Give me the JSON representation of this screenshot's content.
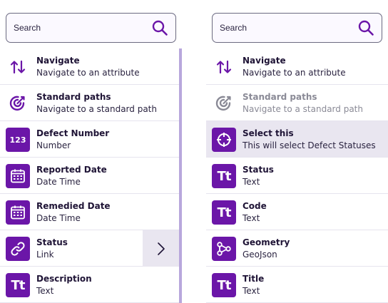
{
  "colors": {
    "accent": "#6b16a8",
    "selected_bg": "#e9e6f0",
    "scrollbar": "#b8a7dc",
    "muted": "#8a8a96"
  },
  "left": {
    "search": {
      "placeholder": "Search",
      "icon": "search-icon"
    },
    "items": [
      {
        "icon": "sort-arrows-icon",
        "title": "Navigate",
        "subtitle": "Navigate to an attribute"
      },
      {
        "icon": "target-icon",
        "title": "Standard paths",
        "subtitle": "Navigate to a standard path"
      },
      {
        "icon": "number-icon",
        "icon_text": "123",
        "title": "Defect Number",
        "subtitle": "Number"
      },
      {
        "icon": "calendar-icon",
        "title": "Reported Date",
        "subtitle": "Date Time"
      },
      {
        "icon": "calendar-icon",
        "title": "Remedied Date",
        "subtitle": "Date Time"
      },
      {
        "icon": "link-icon",
        "title": "Status",
        "subtitle": "Link",
        "action_icon": "chevron-right-icon"
      },
      {
        "icon": "text-icon",
        "icon_text": "Tt",
        "title": "Description",
        "subtitle": "Text"
      }
    ]
  },
  "right": {
    "search": {
      "placeholder": "Search",
      "icon": "search-icon"
    },
    "items": [
      {
        "icon": "sort-arrows-icon",
        "title": "Navigate",
        "subtitle": "Navigate to an attribute"
      },
      {
        "icon": "target-icon",
        "title": "Standard paths",
        "subtitle": "Navigate to a standard path",
        "state": "disabled"
      },
      {
        "icon": "crosshair-icon",
        "title": "Select this",
        "subtitle": "This will select Defect Statuses",
        "state": "selected"
      },
      {
        "icon": "text-icon",
        "icon_text": "Tt",
        "title": "Status",
        "subtitle": "Text"
      },
      {
        "icon": "text-icon",
        "icon_text": "Tt",
        "title": "Code",
        "subtitle": "Text"
      },
      {
        "icon": "geometry-icon",
        "title": "Geometry",
        "subtitle": "GeoJson"
      },
      {
        "icon": "text-icon",
        "icon_text": "Tt",
        "title": "Title",
        "subtitle": "Text"
      }
    ]
  }
}
